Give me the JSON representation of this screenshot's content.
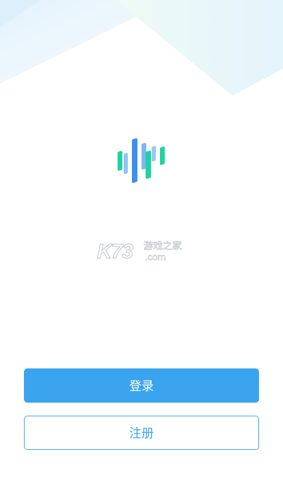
{
  "app": {
    "logo_icon": "sound-wave-logo-icon"
  },
  "watermark": {
    "brand": "K73",
    "cn_text": "游戏之家",
    "domain_suffix": ".com"
  },
  "actions": {
    "login_label": "登录",
    "register_label": "注册"
  },
  "colors": {
    "primary": "#3aa5ee",
    "logo_blue": "#3a8ff0",
    "logo_green": "#1fd3a3",
    "background": "#ffffff"
  }
}
